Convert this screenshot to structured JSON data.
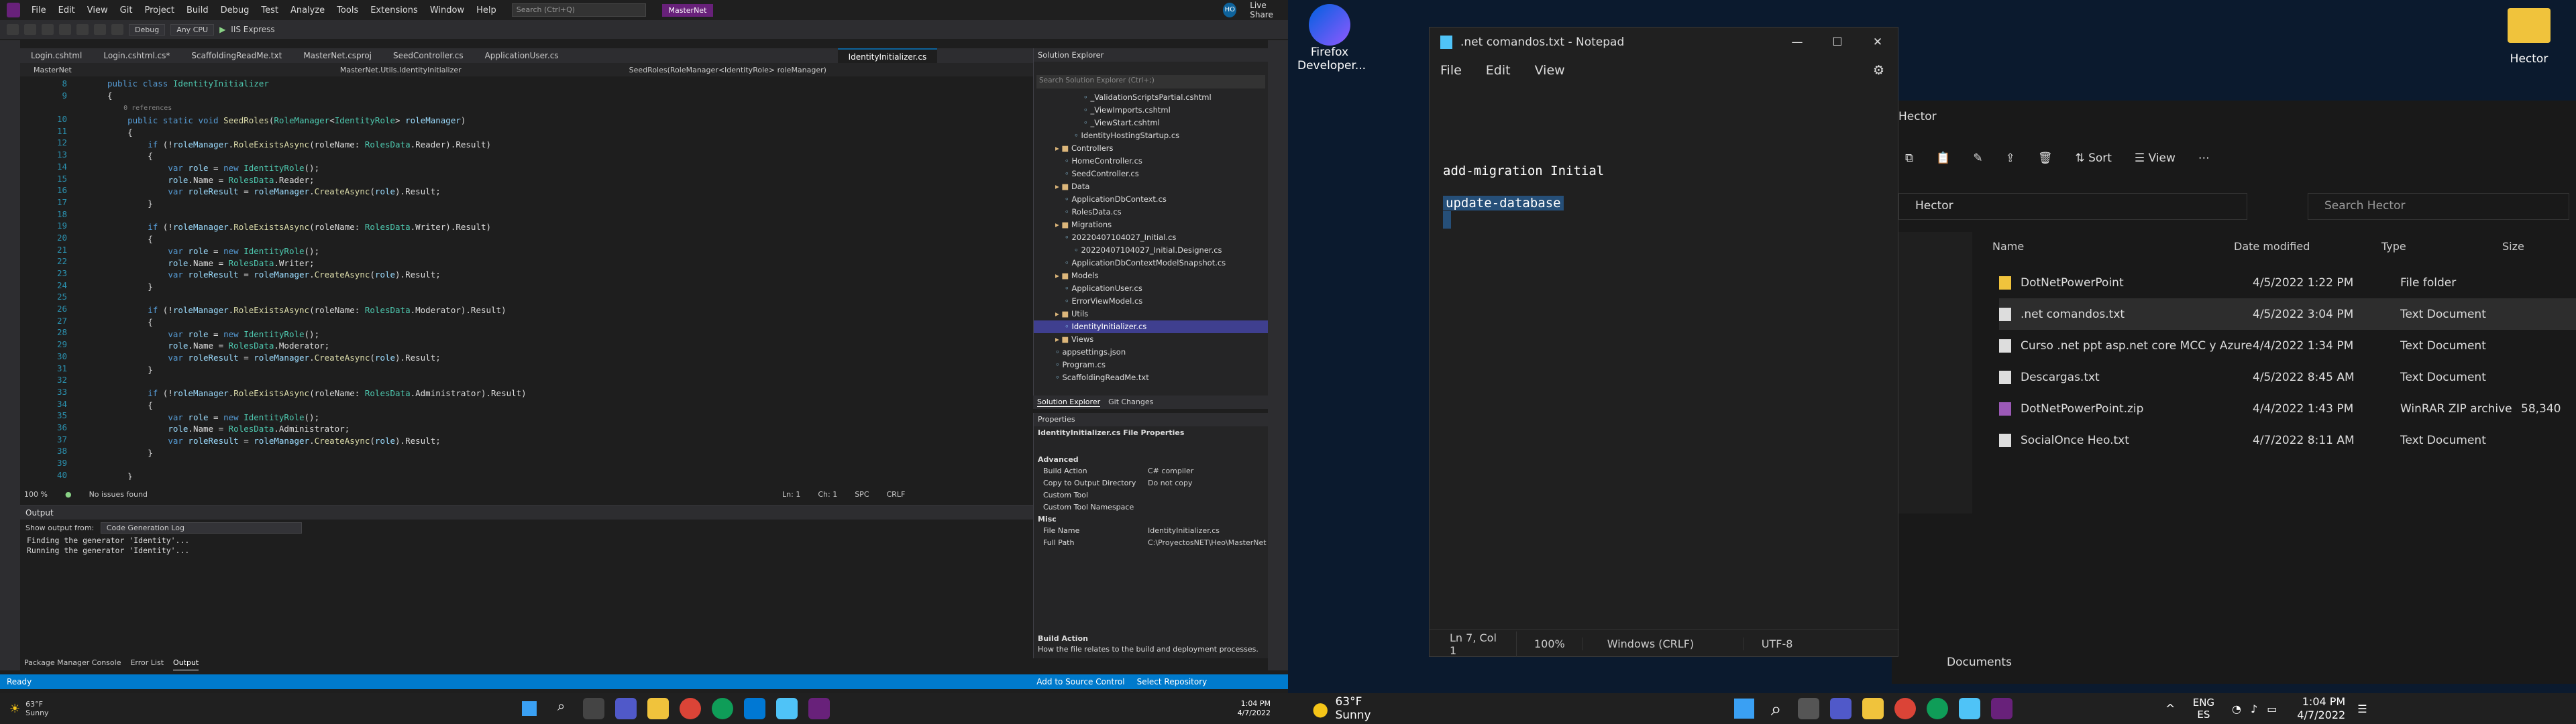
{
  "vs": {
    "menu": [
      "File",
      "Edit",
      "View",
      "Git",
      "Project",
      "Build",
      "Debug",
      "Test",
      "Analyze",
      "Tools",
      "Extensions",
      "Window",
      "Help"
    ],
    "search_placeholder": "Search (Ctrl+Q)",
    "solution_name": "MasterNet",
    "user_initials": "HO",
    "live_share": "Live Share",
    "toolbar": {
      "config": "Debug",
      "platform": "Any CPU",
      "run": "IIS Express"
    },
    "tabs": [
      "Login.cshtml",
      "Login.cshtml.cs*",
      "ScaffoldingReadMe.txt",
      "MasterNet.csproj",
      "SeedController.cs",
      "ApplicationUser.cs"
    ],
    "active_tab": "IdentityInitializer.cs",
    "nav": {
      "project": "MasterNet",
      "class": "MasterNet.Utils.IdentityInitializer",
      "member": "SeedRoles(RoleManager<IdentityRole> roleManager)"
    },
    "line_numbers": [
      "8",
      "9",
      "",
      "10",
      "11",
      "12",
      "13",
      "14",
      "15",
      "16",
      "17",
      "18",
      "19",
      "20",
      "21",
      "22",
      "23",
      "24",
      "25",
      "26",
      "27",
      "28",
      "29",
      "30",
      "31",
      "32",
      "33",
      "34",
      "35",
      "36",
      "37",
      "38",
      "39",
      "40"
    ],
    "editor_status": {
      "zoom": "100 %",
      "issues": "No issues found",
      "ln": "Ln: 1",
      "ch": "Ch: 1",
      "spc": "SPC",
      "crlf": "CRLF"
    },
    "output": {
      "title": "Output",
      "show_from": "Show output from:",
      "source": "Code Generation Log",
      "lines": [
        "Finding the generator 'Identity'...",
        "Running the generator 'Identity'..."
      ]
    },
    "bottom_tabs": [
      "Package Manager Console",
      "Error List",
      "Output"
    ],
    "status": {
      "ready": "Ready",
      "source_control": "Add to Source Control",
      "repo": "Select Repository"
    },
    "solution_explorer": {
      "title": "Solution Explorer",
      "search": "Search Solution Explorer (Ctrl+;)",
      "items": [
        "_ValidationScriptsPartial.cshtml",
        "_ViewImports.cshtml",
        "_ViewStart.cshtml",
        "IdentityHostingStartup.cs",
        "Controllers",
        "HomeController.cs",
        "SeedController.cs",
        "Data",
        "ApplicationDbContext.cs",
        "RolesData.cs",
        "Migrations",
        "20220407104027_Initial.cs",
        "20220407104027_Initial.Designer.cs",
        "ApplicationDbContextModelSnapshot.cs",
        "Models",
        "ApplicationUser.cs",
        "ErrorViewModel.cs",
        "Utils",
        "IdentityInitializer.cs",
        "Views",
        "appsettings.json",
        "Program.cs",
        "ScaffoldingReadMe.txt"
      ],
      "tabs": [
        "Solution Explorer",
        "Git Changes"
      ]
    },
    "properties": {
      "title": "Properties",
      "subject": "IdentityInitializer.cs File Properties",
      "advanced": "Advanced",
      "rows": [
        [
          "Build Action",
          "C# compiler"
        ],
        [
          "Copy to Output Directory",
          "Do not copy"
        ],
        [
          "Custom Tool",
          ""
        ],
        [
          "Custom Tool Namespace",
          ""
        ]
      ],
      "misc": "Misc",
      "misc_rows": [
        [
          "File Name",
          "IdentityInitializer.cs"
        ],
        [
          "Full Path",
          "C:\\ProyectosNET\\Heo\\MasterNet"
        ]
      ],
      "desc_title": "Build Action",
      "desc": "How the file relates to the build and deployment processes."
    },
    "taskbar": {
      "weather": "63°F",
      "weather_desc": "Sunny",
      "time": "1:04 PM",
      "date": "4/7/2022"
    }
  },
  "desktop": {
    "icons": [
      "Firefox Developer...",
      "Hector"
    ]
  },
  "notepad": {
    "title": ".net comandos.txt - Notepad",
    "menu": [
      "File",
      "Edit",
      "View"
    ],
    "lines": [
      "add-migration Initial",
      "update-database"
    ],
    "status": {
      "pos": "Ln 7, Col 1",
      "zoom": "100%",
      "eol": "Windows (CRLF)",
      "enc": "UTF-8"
    }
  },
  "explorer": {
    "title": "Hector",
    "sort": "Sort",
    "view": "View",
    "path": "Hector",
    "search": "Search Hector",
    "cols": [
      "Name",
      "Date modified",
      "Type",
      "Size"
    ],
    "rows": [
      {
        "name": "DotNetPowerPoint",
        "date": "4/5/2022 1:22 PM",
        "type": "File folder",
        "size": ""
      },
      {
        "name": ".net comandos.txt",
        "date": "4/5/2022 3:04 PM",
        "type": "Text Document",
        "size": ""
      },
      {
        "name": "Curso .net ppt asp.net core MCC y Azure...",
        "date": "4/4/2022 1:34 PM",
        "type": "Text Document",
        "size": ""
      },
      {
        "name": "Descargas.txt",
        "date": "4/5/2022 8:45 AM",
        "type": "Text Document",
        "size": ""
      },
      {
        "name": "DotNetPowerPoint.zip",
        "date": "4/4/2022 1:43 PM",
        "type": "WinRAR ZIP archive",
        "size": "58,340"
      },
      {
        "name": "SocialOnce Heo.txt",
        "date": "4/7/2022 8:11 AM",
        "type": "Text Document",
        "size": ""
      }
    ],
    "documents": "Documents"
  },
  "r_taskbar": {
    "weather": "63°F",
    "weather_desc": "Sunny",
    "lang": "ENG",
    "lang2": "ES",
    "time": "1:04 PM",
    "date": "4/7/2022"
  },
  "colors": {
    "vs_accent": "#007acc",
    "vs_purple": "#68217a",
    "selection": "#264f78"
  }
}
